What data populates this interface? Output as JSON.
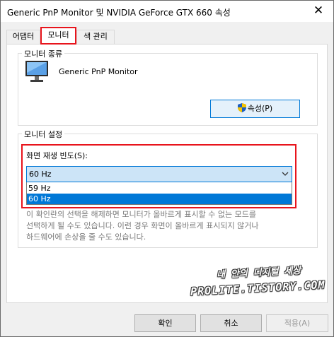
{
  "window": {
    "title": "Generic PnP Monitor 및 NVIDIA GeForce GTX 660 속성",
    "close_glyph": "✕"
  },
  "tabs": [
    {
      "label": "어댑터",
      "selected": false
    },
    {
      "label": "모니터",
      "selected": true
    },
    {
      "label": "색 관리",
      "selected": false
    }
  ],
  "monitor_type": {
    "group_title": "모니터 종류",
    "monitor_name": "Generic PnP Monitor",
    "properties_button": "속성(P)",
    "icon": "monitor-icon"
  },
  "monitor_settings": {
    "group_title": "모니터 설정",
    "refresh_label": "화면 재생 빈도(S):",
    "refresh_value": "60 Hz",
    "options": [
      "59 Hz",
      "60 Hz"
    ],
    "selected_option": "60 Hz",
    "warning_lines": [
      "이 확인란의 선택을 해제하면 모니터가 올바르게 표시할 수 없는 모드를",
      "선택하게 될 수도 있습니다. 이런 경우 화면이 올바르게 표시되지 않거나",
      "하드웨어에 손상을 줄 수도 있습니다."
    ]
  },
  "buttons": {
    "ok": "확인",
    "cancel": "취소",
    "apply": "적용(A)"
  },
  "watermark": {
    "line1": "내 안의 디지털 세상",
    "line2": "PROLITE.TISTORY.COM"
  },
  "colors": {
    "highlight": "#0078d7",
    "annotation_red": "#e8141c",
    "dropdown_bg": "#cce4f7"
  }
}
